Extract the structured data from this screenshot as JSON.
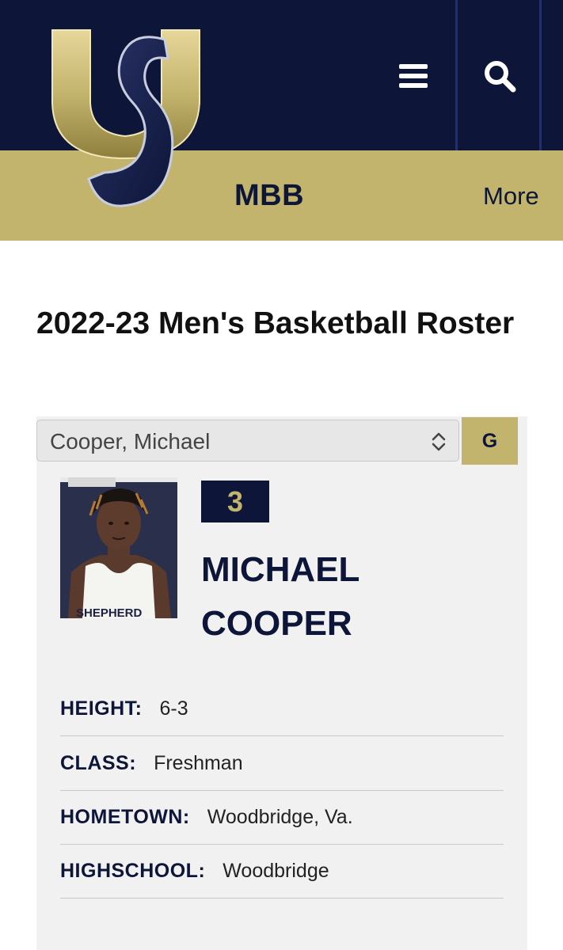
{
  "header": {
    "logo_icon": "university-logo-icon",
    "menu_icon": "hamburger-menu-icon",
    "search_icon": "search-icon",
    "sport_label": "MBB",
    "more_label": "More",
    "colors": {
      "navy": "#0d1538",
      "gold": "#c2b36d"
    }
  },
  "page": {
    "title": "2022-23 Men's Basketball Roster"
  },
  "roster_select": {
    "selected": "Cooper, Michael",
    "chevron_icon": "select-chevron-icon"
  },
  "position_tab": {
    "label": "G"
  },
  "player": {
    "number": "3",
    "first_name": "MICHAEL",
    "last_name": "COOPER",
    "photo_icon": "player-headshot-photo",
    "stats": [
      {
        "label": "HEIGHT:",
        "value": "6-3"
      },
      {
        "label": "CLASS:",
        "value": "Freshman"
      },
      {
        "label": "HOMETOWN:",
        "value": "Woodbridge, Va."
      },
      {
        "label": "HIGHSCHOOL:",
        "value": "Woodbridge"
      }
    ]
  }
}
